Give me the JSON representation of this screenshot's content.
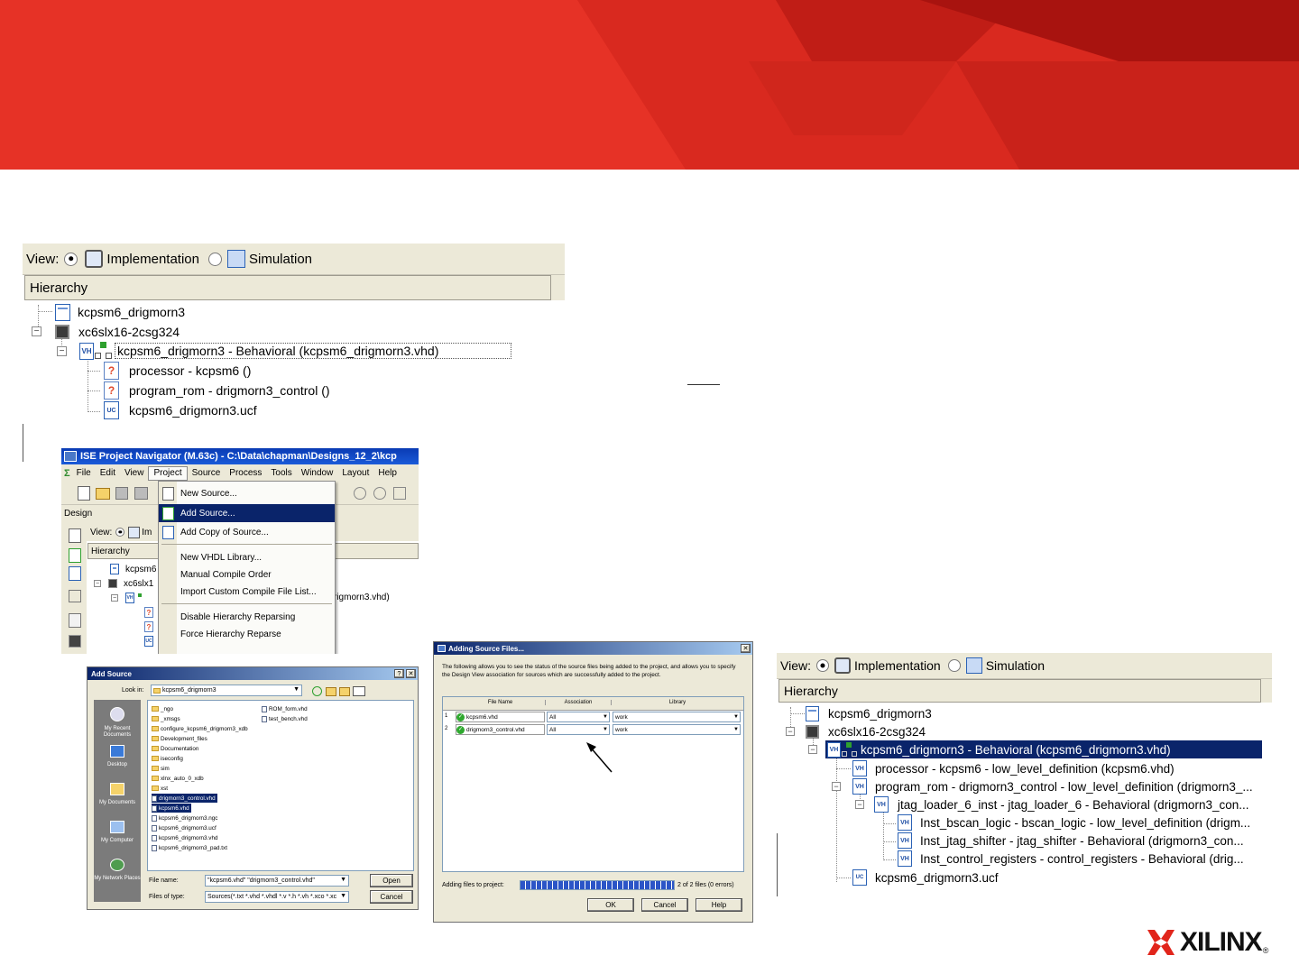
{
  "colors": {
    "banner_red": "#e63226",
    "banner_dark": "#b41a14",
    "xilinx_red": "#e1251b",
    "selection_blue": "#0a246a"
  },
  "top_panel": {
    "view_label": "View:",
    "implementation_label": "Implementation",
    "simulation_label": "Simulation",
    "implementation_selected": true,
    "hierarchy_header": "Hierarchy",
    "items": [
      {
        "label": "kcpsm6_drigmorn3",
        "icon": "project-icon"
      },
      {
        "label": "xc6slx16-2csg324",
        "icon": "chip-icon"
      },
      {
        "label": "kcpsm6_drigmorn3 - Behavioral (kcpsm6_drigmorn3.vhd)",
        "icon": "vhdl-module-icon"
      },
      {
        "label": "processor - kcpsm6 ()",
        "icon": "missing-source-icon"
      },
      {
        "label": "program_rom - drigmorn3_control ()",
        "icon": "missing-source-icon"
      },
      {
        "label": "kcpsm6_drigmorn3.ucf",
        "icon": "ucf-icon"
      }
    ]
  },
  "ise_window": {
    "title": "ISE Project Navigator (M.63c) - C:\\Data\\chapman\\Designs_12_2\\kcp",
    "menus": [
      "File",
      "Edit",
      "View",
      "Project",
      "Source",
      "Process",
      "Tools",
      "Window",
      "Layout",
      "Help"
    ],
    "active_menu": "Project",
    "design_label": "Design",
    "view_label": "View:",
    "view_abbrev": "Im",
    "hierarchy_header": "Hierarchy",
    "tree_items": [
      "kcpsm6",
      "xc6slx1"
    ],
    "behind_text": "rigmorn3.vhd)",
    "project_menu": [
      {
        "label": "New Source...",
        "selected": false,
        "icon": "new-source-icon"
      },
      {
        "label": "Add Source...",
        "selected": true,
        "icon": "add-source-icon"
      },
      {
        "label": "Add Copy of Source...",
        "selected": false,
        "icon": "add-copy-icon"
      },
      {
        "label": "New VHDL Library...",
        "selected": false
      },
      {
        "label": "Manual Compile Order",
        "selected": false
      },
      {
        "label": "Import Custom Compile File List...",
        "selected": false
      },
      {
        "label": "Disable Hierarchy Reparsing",
        "selected": false
      },
      {
        "label": "Force Hierarchy Reparse",
        "selected": false
      }
    ]
  },
  "add_source_dialog": {
    "title": "Add Source",
    "look_in_label": "Look in:",
    "look_in_value": "kcpsm6_drigmorn3",
    "places": [
      "My Recent Documents",
      "Desktop",
      "My Documents",
      "My Computer",
      "My Network Places"
    ],
    "col1": [
      {
        "name": "_ngo",
        "type": "folder"
      },
      {
        "name": "_xmsgs",
        "type": "folder"
      },
      {
        "name": "configure_kcpsm6_drigmorn3_xdb",
        "type": "folder"
      },
      {
        "name": "Development_files",
        "type": "folder"
      },
      {
        "name": "Documentation",
        "type": "folder"
      },
      {
        "name": "iseconfig",
        "type": "folder"
      },
      {
        "name": "sim",
        "type": "folder"
      },
      {
        "name": "xlnx_auto_0_xdb",
        "type": "folder"
      },
      {
        "name": "xst",
        "type": "folder"
      },
      {
        "name": "drigmorn3_control.vhd",
        "type": "file",
        "selected": true
      },
      {
        "name": "kcpsm6.vhd",
        "type": "file",
        "selected": true
      },
      {
        "name": "kcpsm6_drigmorn3.ngc",
        "type": "file"
      },
      {
        "name": "kcpsm6_drigmorn3.ucf",
        "type": "file"
      },
      {
        "name": "kcpsm6_drigmorn3.vhd",
        "type": "file"
      },
      {
        "name": "kcpsm6_drigmorn3_pad.txt",
        "type": "file"
      }
    ],
    "col2": [
      {
        "name": "ROM_form.vhd",
        "type": "file"
      },
      {
        "name": "test_bench.vhd",
        "type": "file"
      }
    ],
    "file_name_label": "File name:",
    "file_name_value": "\"kcpsm6.vhd\" \"drigmorn3_control.vhd\"",
    "files_of_type_label": "Files of type:",
    "files_of_type_value": "Sources(*.txt *.vhd *.vhdl *.v *.h *.vh *.xco *.xc",
    "open_label": "Open",
    "cancel_label": "Cancel",
    "help_label": "?"
  },
  "adding_dialog": {
    "title": "Adding Source Files...",
    "description": "The following allows you to see the status of the source files being added to the project, and allows you to specify the Design View association for sources which are successfully added to the project.",
    "columns": [
      "File Name",
      "Association",
      "Library"
    ],
    "rows": [
      {
        "num": "1",
        "file": "kcpsm6.vhd",
        "association": "All",
        "library": "work"
      },
      {
        "num": "2",
        "file": "drigmorn3_control.vhd",
        "association": "All",
        "library": "work"
      }
    ],
    "progress_label": "Adding files to project:",
    "progress_fraction": 1.0,
    "progress_status": "2 of 2 files (0 errors)",
    "ok_label": "OK",
    "cancel_label": "Cancel",
    "help_label": "Help"
  },
  "right_panel": {
    "view_label": "View:",
    "implementation_label": "Implementation",
    "simulation_label": "Simulation",
    "implementation_selected": true,
    "hierarchy_header": "Hierarchy",
    "items": [
      {
        "label": "kcpsm6_drigmorn3",
        "icon": "project-icon"
      },
      {
        "label": "xc6slx16-2csg324",
        "icon": "chip-icon"
      },
      {
        "label": "kcpsm6_drigmorn3 - Behavioral (kcpsm6_drigmorn3.vhd)",
        "icon": "vhdl-module-icon",
        "selected": true
      },
      {
        "label": "processor - kcpsm6 - low_level_definition (kcpsm6.vhd)",
        "icon": "vhdl-icon"
      },
      {
        "label": "program_rom - drigmorn3_control - low_level_definition (drigmorn3_...",
        "icon": "vhdl-icon"
      },
      {
        "label": "jtag_loader_6_inst - jtag_loader_6 - Behavioral (drigmorn3_con...",
        "icon": "vhdl-icon"
      },
      {
        "label": "Inst_bscan_logic - bscan_logic - low_level_definition (drigm...",
        "icon": "vhdl-icon"
      },
      {
        "label": "Inst_jtag_shifter - jtag_shifter - Behavioral (drigmorn3_con...",
        "icon": "vhdl-icon"
      },
      {
        "label": "Inst_control_registers - control_registers - Behavioral (drig...",
        "icon": "vhdl-icon"
      },
      {
        "label": "kcpsm6_drigmorn3.ucf",
        "icon": "ucf-icon"
      }
    ]
  },
  "logo": {
    "text": "XILINX",
    "registered": "®"
  }
}
